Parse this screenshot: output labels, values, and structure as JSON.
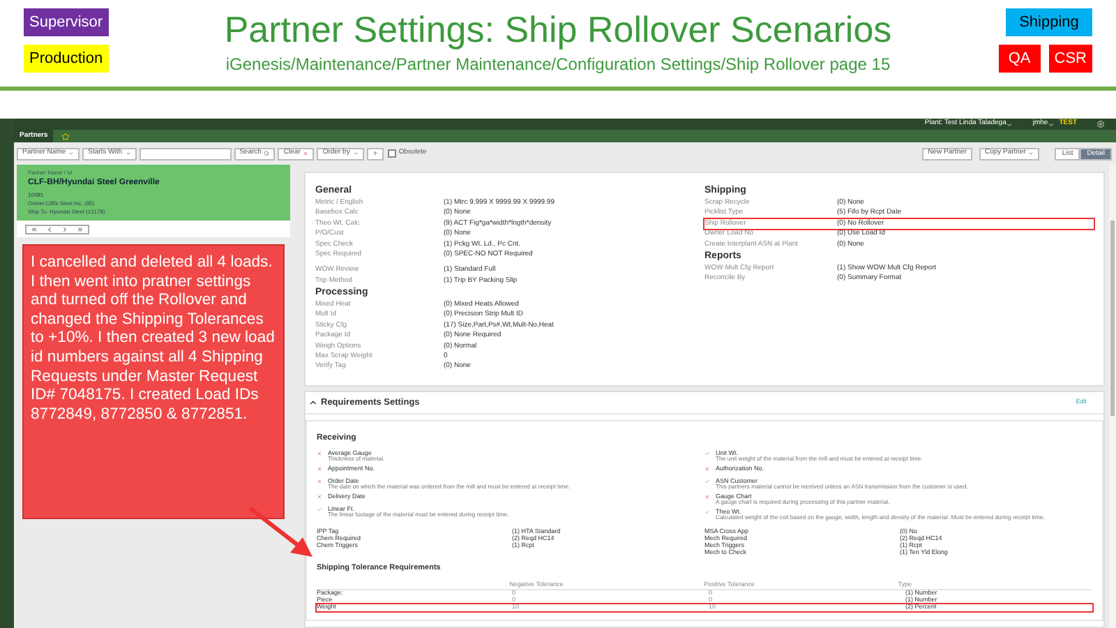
{
  "slide": {
    "tags_left": [
      {
        "label": "Supervisor",
        "color": "#7030a0"
      },
      {
        "label": "Production",
        "color": "#ffff00"
      }
    ],
    "title": "Partner Settings: Ship Rollover Scenarios",
    "subtitle": "iGenesis/Maintenance/Partner Maintenance/Configuration Settings/Ship Rollover page 15",
    "tags_right": [
      {
        "label": "Shipping",
        "color": "#00b0f0"
      },
      {
        "label": "QA",
        "color": "#ff0000"
      },
      {
        "label": "CSR",
        "color": "#ff0000"
      }
    ]
  },
  "header": {
    "plant": "Plant: Test Linda Taladega",
    "user": "jmhe",
    "env": "TEST"
  },
  "nav_tabs": [
    {
      "label": "Partners",
      "selected": true
    }
  ],
  "toolbar": {
    "filters": [
      "Partner Name",
      "Starts With"
    ],
    "search": "Search",
    "clear": "Clear",
    "order_by": "Order by",
    "obsolete": {
      "label": "Obsolete",
      "checked": false
    },
    "actions": [
      {
        "label": "New Partner",
        "dropdown": false
      },
      {
        "label": "Copy Partner",
        "dropdown": true
      }
    ],
    "views": [
      {
        "label": "List",
        "selected": false
      },
      {
        "label": "Detail",
        "selected": true
      }
    ]
  },
  "partner_card": {
    "caption": "Partner Name / Id",
    "name": "CLF-BH/Hyundai Steel Greenville",
    "id": "10091",
    "owner": "Owner:Cliffs Steel Inc. (85)",
    "ship_to": "Ship To: Hyundai Steel (12178)"
  },
  "callout": "I cancelled and deleted all 4 loads. I then went into pratner settings and turned off the Rollover and changed the Shipping Tolerances to +10%. I then created 3 new load id numbers against all 4 Shipping Requests under Master Request ID# 7048175. I created Load IDs 8772849, 8772850 & 8772851.",
  "settings": {
    "columns": [
      [
        {
          "title": "General",
          "groups": [
            [
              {
                "label": "Metric / English",
                "value": "(1) Mtrc 9.999 X 9999.99 X 9999.99",
                "highlighted": false
              },
              {
                "label": "Basebox Calc",
                "value": "(0) None",
                "highlighted": false
              },
              {
                "label": "Theo Wt. Calc",
                "value": "(9) ACT Fig*ga*width*lngth*density",
                "highlighted": false
              },
              {
                "label": "P/O/Cust",
                "value": "(0) None",
                "highlighted": false
              },
              {
                "label": "Spec Check",
                "value": "(1) Pckg Wt. Ld., Pc Cnt.",
                "highlighted": false
              },
              {
                "label": "Spec Required",
                "value": "(0) SPEC-NO NOT Required",
                "highlighted": false
              }
            ],
            [
              {
                "label": "WOW Review",
                "value": "(1) Standard Full",
                "highlighted": false
              },
              {
                "label": "Trip Method",
                "value": "(1) Trip BY Packing Slip",
                "highlighted": false
              }
            ]
          ]
        },
        {
          "title": "Processing",
          "groups": [
            [
              {
                "label": "Mixed Heat",
                "value": "(0) Mixed Heats Allowed",
                "highlighted": false
              },
              {
                "label": "Mult Id",
                "value": "(0) Precision Strip Mult ID",
                "highlighted": false
              },
              {
                "label": "Sticky Cfg",
                "value": "(17) Size,Part,Ps#,Wt,Mult-No,Heat",
                "highlighted": false
              },
              {
                "label": "Package Id",
                "value": "(0) None Required",
                "highlighted": false
              },
              {
                "label": "Weigh Options",
                "value": "(0) Normal",
                "highlighted": false
              },
              {
                "label": "Max Scrap Weight",
                "value": "0",
                "highlighted": false
              },
              {
                "label": "Verify Tag",
                "value": "(0) None",
                "highlighted": false
              }
            ]
          ]
        }
      ],
      [
        {
          "title": "Shipping",
          "groups": [
            [
              {
                "label": "Scrap Recycle",
                "value": "(0) None",
                "highlighted": false
              },
              {
                "label": "Picklist Type",
                "value": "(5) Fifo by Rcpt Date",
                "highlighted": false
              },
              {
                "label": "Ship Rollover",
                "value": "(0) No Rollover",
                "highlighted": true
              },
              {
                "label": "Owner Load No",
                "value": "(0) Use Load Id",
                "highlighted": false
              },
              {
                "label": "Create Interplant ASN at Plant",
                "value": "(0) None",
                "highlighted": false
              }
            ]
          ]
        },
        {
          "title": "Reports",
          "groups": [
            [
              {
                "label": "WOW Mult Cfg Report",
                "value": "(1) Show WOW Mult Cfg Report",
                "highlighted": false
              },
              {
                "label": "Reconcile By",
                "value": "(0) Summary Format",
                "highlighted": false
              }
            ]
          ]
        }
      ]
    ]
  },
  "requirements": {
    "title": "Requirements Settings",
    "expanded": true,
    "edit": "Edit",
    "receiving": "Receiving",
    "checks": [
      [
        {
          "label": "Average Gauge",
          "description": "Thickness of material.",
          "required": false
        },
        {
          "label": "Appointment No.",
          "required": false
        },
        {
          "label": "Order Date",
          "description": "The date on which the material was ordered from the mill and must be entered at receipt time.",
          "required": false
        },
        {
          "label": "Delivery Date",
          "required": false
        },
        {
          "label": "Linear Ft.",
          "description": "The linear footage of the material must be entered during receipt time.",
          "required": true
        }
      ],
      [
        {
          "label": "Unit Wt.",
          "description": "The unit weight of the material from the mill and must be entered at receipt time.",
          "required": true
        },
        {
          "label": "Authorization No.",
          "required": false
        },
        {
          "label": "ASN Customer",
          "description": "This partners material cannot be received unless an ASN transmission from the customer is used.",
          "required": true
        },
        {
          "label": "Gauge Chart",
          "description": "A gauge chart is required during processing of this partner material.",
          "required": false
        },
        {
          "label": "Theo Wt.",
          "description": "Calculated weight of the coil based on the gauge, width, length and density of the material. Must be entered during receipt time.",
          "required": true
        }
      ]
    ],
    "codes": [
      [
        {
          "label": "IPP Tag",
          "value": "(1) HTA Standard"
        },
        {
          "label": "Chem Required",
          "value": "(2) Reqd HC14"
        },
        {
          "label": "Chem Triggers",
          "value": "(1) Rcpt"
        }
      ],
      [
        {
          "label": "MSA Cross App",
          "value": "(0) No"
        },
        {
          "label": "Mech Required",
          "value": "(2) Reqd HC14"
        },
        {
          "label": "Mech Triggers",
          "value": "(1) Rcpt"
        },
        {
          "label": "Mech to Check",
          "value": "(1) Ten Yld Elong"
        }
      ]
    ],
    "tolerance": {
      "title": "Shipping Tolerance Requirements",
      "columns": [
        "Negative Tolerance",
        "Positive Tolerance",
        "Type"
      ],
      "rows": [
        {
          "label": "Package:",
          "negative": "0",
          "positive": "0",
          "type": "(1) Number",
          "highlighted": false
        },
        {
          "label": "Piece",
          "negative": "0",
          "positive": "0",
          "type": "(1) Number",
          "highlighted": false
        },
        {
          "label": "Weight",
          "negative": "10",
          "positive": "10",
          "type": "(2) Percent",
          "highlighted": true
        }
      ]
    }
  }
}
